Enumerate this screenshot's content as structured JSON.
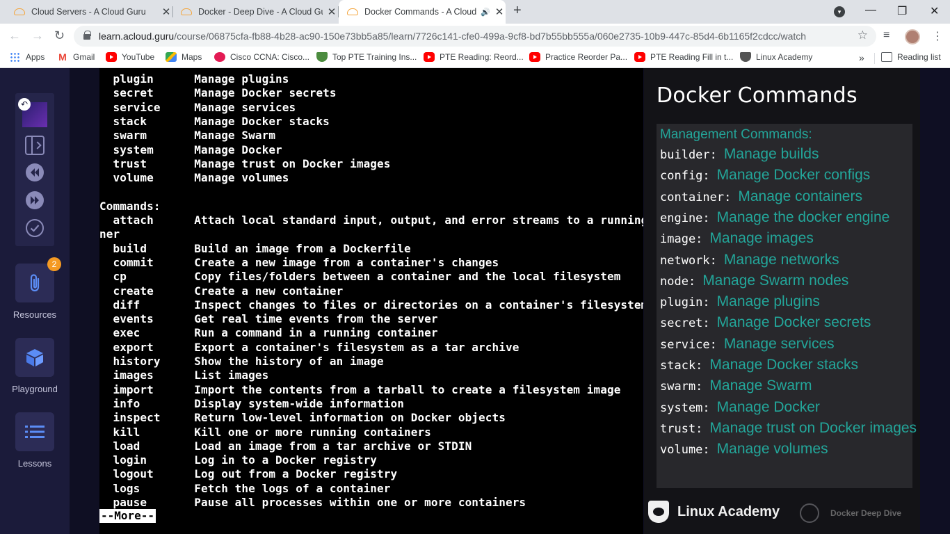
{
  "browser": {
    "tabs": [
      {
        "title": "Cloud Servers - A Cloud Guru",
        "close": "✕"
      },
      {
        "title": "Docker - Deep Dive - A Cloud Gu",
        "close": "✕"
      },
      {
        "title": "Docker Commands - A Cloud",
        "audio": "🔊",
        "close": "✕"
      }
    ],
    "new_tab": "+",
    "window_controls": {
      "minimize": "—",
      "maximize": "❐",
      "close": "✕"
    },
    "nav": {
      "back": "←",
      "forward": "→",
      "reload": "↻"
    },
    "url_host": "learn.acloud.guru",
    "url_path": "/course/06875cfa-fb88-4b28-ac90-150e73bb5a85/learn/7726c141-cfe0-499a-9cf8-bd7b55bb555a/060e2735-10b9-447c-85d4-6b1165f2cdcc/watch",
    "star": "☆",
    "bookmarks": [
      {
        "label": "Apps",
        "icon": "apps-grid-icon"
      },
      {
        "label": "Gmail",
        "icon": "gmail-icon"
      },
      {
        "label": "YouTube",
        "icon": "youtube-icon"
      },
      {
        "label": "Maps",
        "icon": "maps-icon"
      },
      {
        "label": "Cisco CCNA: Cisco...",
        "icon": "cisco-icon"
      },
      {
        "label": "Top PTE Training Ins...",
        "icon": "shield-icon"
      },
      {
        "label": "PTE Reading: Reord...",
        "icon": "youtube-icon"
      },
      {
        "label": "Practice Reorder Pa...",
        "icon": "youtube-icon"
      },
      {
        "label": "PTE Reading Fill in t...",
        "icon": "youtube-icon"
      },
      {
        "label": "Linux Academy",
        "icon": "linux-academy-icon"
      }
    ],
    "bookmarks_more": "»",
    "reading_list": "Reading list"
  },
  "sidebar": {
    "resources_label": "Resources",
    "resources_badge": "2",
    "playground_label": "Playground",
    "lessons_label": "Lessons"
  },
  "terminal": {
    "lines": [
      "  plugin      Manage plugins",
      "  secret      Manage Docker secrets",
      "  service     Manage services",
      "  stack       Manage Docker stacks",
      "  swarm       Manage Swarm",
      "  system      Manage Docker",
      "  trust       Manage trust on Docker images",
      "  volume      Manage volumes",
      "",
      "Commands:",
      "  attach      Attach local standard input, output, and error streams to a running contai",
      "ner",
      "  build       Build an image from a Dockerfile",
      "  commit      Create a new image from a container's changes",
      "  cp          Copy files/folders between a container and the local filesystem",
      "  create      Create a new container",
      "  diff        Inspect changes to files or directories on a container's filesystem",
      "  events      Get real time events from the server",
      "  exec        Run a command in a running container",
      "  export      Export a container's filesystem as a tar archive",
      "  history     Show the history of an image",
      "  images      List images",
      "  import      Import the contents from a tarball to create a filesystem image",
      "  info        Display system-wide information",
      "  inspect     Return low-level information on Docker objects",
      "  kill        Kill one or more running containers",
      "  load        Load an image from a tar archive or STDIN",
      "  login       Log in to a Docker registry",
      "  logout      Log out from a Docker registry",
      "  logs        Fetch the logs of a container",
      "  pause       Pause all processes within one or more containers"
    ],
    "more_prompt": "--More--"
  },
  "slide": {
    "title": "Docker Commands",
    "section": "Management Commands:",
    "commands": [
      {
        "name": "builder:",
        "desc": "Manage builds"
      },
      {
        "name": "config:",
        "desc": "Manage Docker configs"
      },
      {
        "name": "container:",
        "desc": "Manage containers"
      },
      {
        "name": "engine:",
        "desc": "Manage the docker engine"
      },
      {
        "name": "image:",
        "desc": "Manage images"
      },
      {
        "name": "network:",
        "desc": "Manage networks"
      },
      {
        "name": "node:",
        "desc": "Manage Swarm nodes"
      },
      {
        "name": "plugin:",
        "desc": "Manage plugins"
      },
      {
        "name": "secret:",
        "desc": "Manage Docker secrets"
      },
      {
        "name": "service:",
        "desc": "Manage services"
      },
      {
        "name": "stack:",
        "desc": "Manage Docker stacks"
      },
      {
        "name": "swarm:",
        "desc": "Manage Swarm"
      },
      {
        "name": "system:",
        "desc": "Manage Docker"
      },
      {
        "name": "trust:",
        "desc": "Manage trust on Docker images"
      },
      {
        "name": "volume:",
        "desc": "Manage volumes"
      }
    ],
    "brand": "Linux Academy",
    "course": "Docker Deep Dive"
  },
  "colors": {
    "accent_teal": "#23a69a",
    "sidebar_bg": "#1b1b3a",
    "badge_orange": "#f59a23"
  }
}
